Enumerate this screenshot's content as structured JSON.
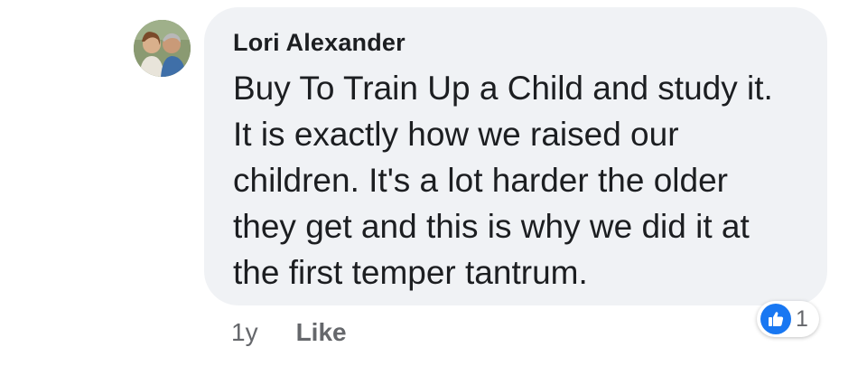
{
  "comment": {
    "author": "Lori Alexander",
    "text": "Buy To Train Up a Child and study it. It is exactly how we raised our children. It's a lot harder the older they get and this is why we did it at the first temper tantrum.",
    "timestamp": "1y",
    "like_label": "Like",
    "reaction_icon": "thumbs-up-icon",
    "reaction_count": "1",
    "accent_color": "#1877f2",
    "bubble_color": "#f0f2f5"
  }
}
